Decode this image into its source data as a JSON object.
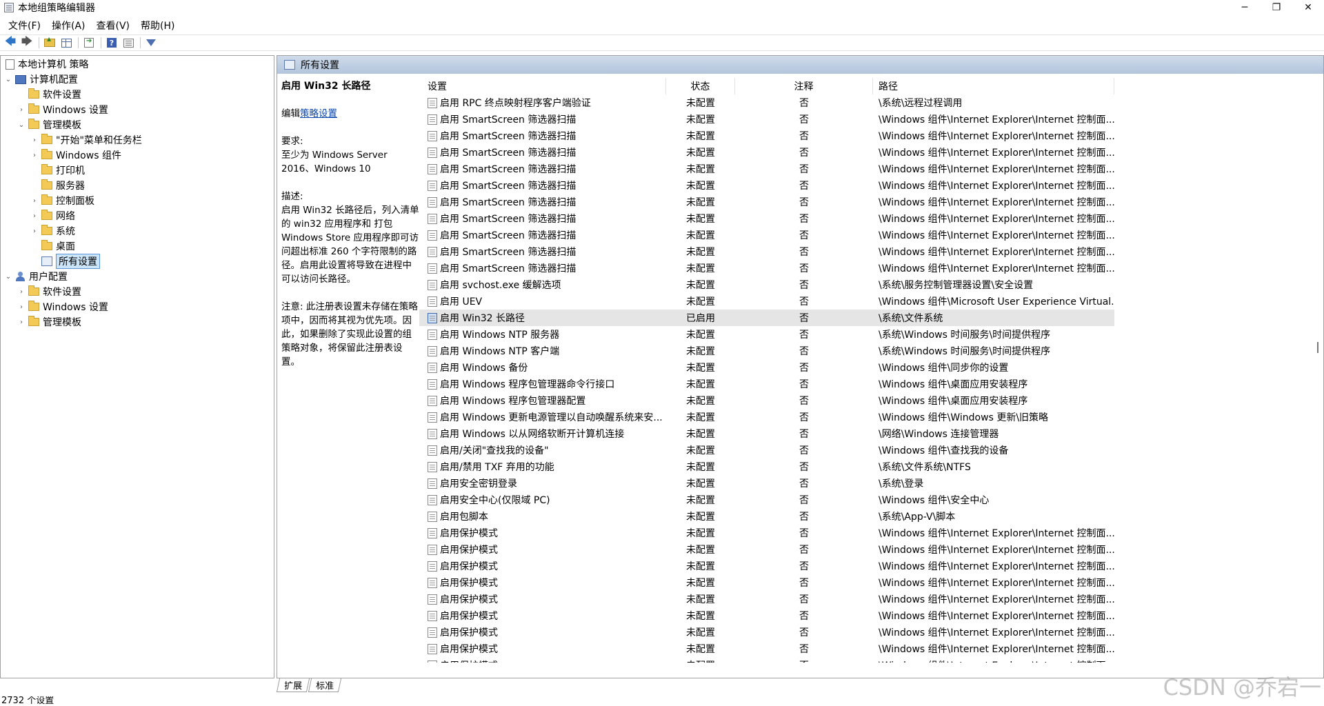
{
  "window": {
    "title": "本地组策略编辑器",
    "minimize": "─",
    "maximize": "❐",
    "close": "✕"
  },
  "menu": [
    "文件(F)",
    "操作(A)",
    "查看(V)",
    "帮助(H)"
  ],
  "tree": {
    "root": "本地计算机 策略",
    "computer_config": "计算机配置",
    "software_settings": "软件设置",
    "windows_settings": "Windows 设置",
    "admin_templates": "管理模板",
    "start_menu": "\"开始\"菜单和任务栏",
    "windows_components": "Windows 组件",
    "printers": "打印机",
    "server": "服务器",
    "control_panel": "控制面板",
    "network": "网络",
    "system": "系统",
    "desktop": "桌面",
    "all_settings": "所有设置",
    "user_config": "用户配置",
    "user_software_settings": "软件设置",
    "user_windows_settings": "Windows 设置",
    "user_admin_templates": "管理模板"
  },
  "header": {
    "title": "所有设置"
  },
  "description": {
    "title": "启用 Win32 长路径",
    "edit_prefix": "编辑",
    "edit_link": "策略设置",
    "req_label": "要求:",
    "req_text": "至少为 Windows Server 2016、Windows 10",
    "desc_label": "描述:",
    "desc_text": "启用 Win32 长路径后，列入清单的 win32 应用程序和 打包 Windows Store 应用程序即可访问超出标准 260 个字符限制的路径。启用此设置将导致在进程中可以访问长路径。",
    "note_text": "注意: 此注册表设置未存储在策略项中，因而将其视为优先项。因此，如果删除了实现此设置的组策略对象，将保留此注册表设置。"
  },
  "columns": {
    "setting": "设置",
    "state": "状态",
    "note": "注释",
    "path": "路径"
  },
  "rows": [
    {
      "setting": "启用 RPC 终点映射程序客户端验证",
      "state": "未配置",
      "note": "否",
      "path": "\\系统\\远程过程调用"
    },
    {
      "setting": "启用 SmartScreen 筛选器扫描",
      "state": "未配置",
      "note": "否",
      "path": "\\Windows 组件\\Internet Explorer\\Internet 控制面..."
    },
    {
      "setting": "启用 SmartScreen 筛选器扫描",
      "state": "未配置",
      "note": "否",
      "path": "\\Windows 组件\\Internet Explorer\\Internet 控制面..."
    },
    {
      "setting": "启用 SmartScreen 筛选器扫描",
      "state": "未配置",
      "note": "否",
      "path": "\\Windows 组件\\Internet Explorer\\Internet 控制面..."
    },
    {
      "setting": "启用 SmartScreen 筛选器扫描",
      "state": "未配置",
      "note": "否",
      "path": "\\Windows 组件\\Internet Explorer\\Internet 控制面..."
    },
    {
      "setting": "启用 SmartScreen 筛选器扫描",
      "state": "未配置",
      "note": "否",
      "path": "\\Windows 组件\\Internet Explorer\\Internet 控制面..."
    },
    {
      "setting": "启用 SmartScreen 筛选器扫描",
      "state": "未配置",
      "note": "否",
      "path": "\\Windows 组件\\Internet Explorer\\Internet 控制面..."
    },
    {
      "setting": "启用 SmartScreen 筛选器扫描",
      "state": "未配置",
      "note": "否",
      "path": "\\Windows 组件\\Internet Explorer\\Internet 控制面..."
    },
    {
      "setting": "启用 SmartScreen 筛选器扫描",
      "state": "未配置",
      "note": "否",
      "path": "\\Windows 组件\\Internet Explorer\\Internet 控制面..."
    },
    {
      "setting": "启用 SmartScreen 筛选器扫描",
      "state": "未配置",
      "note": "否",
      "path": "\\Windows 组件\\Internet Explorer\\Internet 控制面..."
    },
    {
      "setting": "启用 SmartScreen 筛选器扫描",
      "state": "未配置",
      "note": "否",
      "path": "\\Windows 组件\\Internet Explorer\\Internet 控制面..."
    },
    {
      "setting": "启用 svchost.exe 缓解选项",
      "state": "未配置",
      "note": "否",
      "path": "\\系统\\服务控制管理器设置\\安全设置"
    },
    {
      "setting": "启用 UEV",
      "state": "未配置",
      "note": "否",
      "path": "\\Windows 组件\\Microsoft User Experience Virtual..."
    },
    {
      "setting": "启用 Win32 长路径",
      "state": "已启用",
      "note": "否",
      "path": "\\系统\\文件系统"
    },
    {
      "setting": "启用 Windows NTP 服务器",
      "state": "未配置",
      "note": "否",
      "path": "\\系统\\Windows 时间服务\\时间提供程序"
    },
    {
      "setting": "启用 Windows NTP 客户端",
      "state": "未配置",
      "note": "否",
      "path": "\\系统\\Windows 时间服务\\时间提供程序"
    },
    {
      "setting": "启用 Windows 备份",
      "state": "未配置",
      "note": "否",
      "path": "\\Windows 组件\\同步你的设置"
    },
    {
      "setting": "启用 Windows 程序包管理器命令行接口",
      "state": "未配置",
      "note": "否",
      "path": "\\Windows 组件\\桌面应用安装程序"
    },
    {
      "setting": "启用 Windows 程序包管理器配置",
      "state": "未配置",
      "note": "否",
      "path": "\\Windows 组件\\桌面应用安装程序"
    },
    {
      "setting": "启用 Windows 更新电源管理以自动唤醒系统来安...",
      "state": "未配置",
      "note": "否",
      "path": "\\Windows 组件\\Windows 更新\\旧策略"
    },
    {
      "setting": "启用 Windows 以从网络软断开计算机连接",
      "state": "未配置",
      "note": "否",
      "path": "\\网络\\Windows 连接管理器"
    },
    {
      "setting": "启用/关闭\"查找我的设备\"",
      "state": "未配置",
      "note": "否",
      "path": "\\Windows 组件\\查找我的设备"
    },
    {
      "setting": "启用/禁用 TXF 弃用的功能",
      "state": "未配置",
      "note": "否",
      "path": "\\系统\\文件系统\\NTFS"
    },
    {
      "setting": "启用安全密钥登录",
      "state": "未配置",
      "note": "否",
      "path": "\\系统\\登录"
    },
    {
      "setting": "启用安全中心(仅限域 PC)",
      "state": "未配置",
      "note": "否",
      "path": "\\Windows 组件\\安全中心"
    },
    {
      "setting": "启用包脚本",
      "state": "未配置",
      "note": "否",
      "path": "\\系统\\App-V\\脚本"
    },
    {
      "setting": "启用保护模式",
      "state": "未配置",
      "note": "否",
      "path": "\\Windows 组件\\Internet Explorer\\Internet 控制面..."
    },
    {
      "setting": "启用保护模式",
      "state": "未配置",
      "note": "否",
      "path": "\\Windows 组件\\Internet Explorer\\Internet 控制面..."
    },
    {
      "setting": "启用保护模式",
      "state": "未配置",
      "note": "否",
      "path": "\\Windows 组件\\Internet Explorer\\Internet 控制面..."
    },
    {
      "setting": "启用保护模式",
      "state": "未配置",
      "note": "否",
      "path": "\\Windows 组件\\Internet Explorer\\Internet 控制面..."
    },
    {
      "setting": "启用保护模式",
      "state": "未配置",
      "note": "否",
      "path": "\\Windows 组件\\Internet Explorer\\Internet 控制面..."
    },
    {
      "setting": "启用保护模式",
      "state": "未配置",
      "note": "否",
      "path": "\\Windows 组件\\Internet Explorer\\Internet 控制面..."
    },
    {
      "setting": "启用保护模式",
      "state": "未配置",
      "note": "否",
      "path": "\\Windows 组件\\Internet Explorer\\Internet 控制面..."
    },
    {
      "setting": "启用保护模式",
      "state": "未配置",
      "note": "否",
      "path": "\\Windows 组件\\Internet Explorer\\Internet 控制面..."
    },
    {
      "setting": "启用保护模式",
      "state": "未配置",
      "note": "否",
      "path": "\\Windows 组件\\Internet Explorer\\Internet 控制面..."
    }
  ],
  "tabs": [
    "扩展",
    "标准"
  ],
  "status": "2732 个设置",
  "watermark": "CSDN @乔宕一"
}
